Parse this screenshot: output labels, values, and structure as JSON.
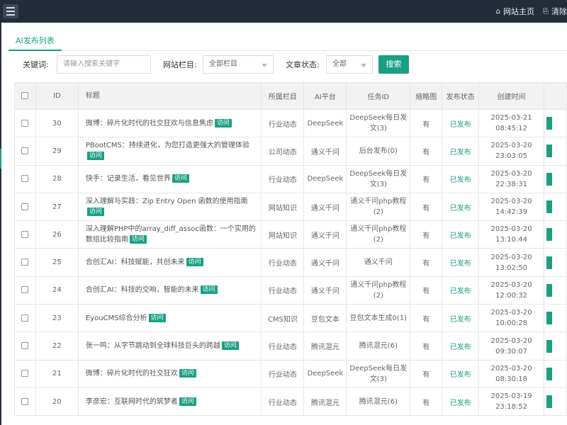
{
  "topbar": {
    "links": [
      {
        "icon": "home-icon",
        "glyph": "⌂",
        "label": "网站主页"
      },
      {
        "icon": "trash-icon",
        "glyph": "⎘",
        "label": "清除"
      }
    ]
  },
  "tab": {
    "label": "AI发布列表"
  },
  "filters": {
    "keyword_label": "关键词:",
    "keyword_placeholder": "请输入搜索关键字",
    "column_label": "网站栏目:",
    "column_value": "全部栏目",
    "status_label": "文章状态:",
    "status_value": "全部",
    "search_button": "搜索"
  },
  "table": {
    "headers": [
      "ID",
      "标题",
      "所属栏目",
      "AI平台",
      "任务ID",
      "缩略图",
      "发布状态",
      "创建时间"
    ],
    "visit_label": "访问",
    "rows": [
      {
        "id": "30",
        "title": "微博：碎片化时代的社交狂欢与信息焦虑",
        "column": "行业动态",
        "platform": "DeepSeek",
        "task": "DeepSeek每日发文(3)",
        "thumb": "有",
        "status": "已发布",
        "date": "2025-03-21",
        "time": "08:45:12"
      },
      {
        "id": "29",
        "title": "PBootCMS：持续进化，为您打造更强大的管理体验",
        "column": "公司动态",
        "platform": "通义千问",
        "task": "后台发布(0)",
        "thumb": "有",
        "status": "已发布",
        "date": "2025-03-20",
        "time": "23:03:05"
      },
      {
        "id": "28",
        "title": "快手：记录生活，看见世界",
        "column": "行业动态",
        "platform": "DeepSeek",
        "task": "DeepSeek每日发文(3)",
        "thumb": "有",
        "status": "已发布",
        "date": "2025-03-20",
        "time": "22:38:31"
      },
      {
        "id": "27",
        "title": "深入理解与实践：Zip Entry Open 函数的使用指南",
        "column": "网站知识",
        "platform": "通义千问",
        "task": "通义千问php教程(2)",
        "thumb": "有",
        "status": "已发布",
        "date": "2025-03-20",
        "time": "14:42:39"
      },
      {
        "id": "26",
        "title": "深入理解PHP中的array_diff_assoc函数：一个实用的数组比较指南",
        "column": "网站知识",
        "platform": "通义千问",
        "task": "通义千问php教程(2)",
        "thumb": "有",
        "status": "已发布",
        "date": "2025-03-20",
        "time": "13:10:44"
      },
      {
        "id": "25",
        "title": "合创汇AI：科技赋能，共创未来",
        "column": "行业动态",
        "platform": "通义千问",
        "task": "通义千问",
        "thumb": "有",
        "status": "已发布",
        "date": "2025-03-20",
        "time": "13:02:50"
      },
      {
        "id": "24",
        "title": "合创汇AI：科技的交响，智能的未来",
        "column": "行业动态",
        "platform": "通义千问",
        "task": "通义千问php教程(2)",
        "thumb": "有",
        "status": "已发布",
        "date": "2025-03-20",
        "time": "12:00:32"
      },
      {
        "id": "23",
        "title": "EyouCMS综合分析",
        "column": "CMS知识",
        "platform": "豆包文本",
        "task": "豆包文本生成0(1)",
        "thumb": "有",
        "status": "已发布",
        "date": "2025-03-20",
        "time": "10:00:28"
      },
      {
        "id": "22",
        "title": "张一鸣：从字节跳动到全球科技巨头的跨越",
        "column": "行业动态",
        "platform": "腾讯混元",
        "task": "腾讯混元(6)",
        "thumb": "有",
        "status": "已发布",
        "date": "2025-03-20",
        "time": "09:30:07"
      },
      {
        "id": "21",
        "title": "微博：碎片化时代的社交狂欢",
        "column": "行业动态",
        "platform": "DeepSeek",
        "task": "DeepSeek每日发文(3)",
        "thumb": "有",
        "status": "已发布",
        "date": "2025-03-20",
        "time": "08:30:18"
      },
      {
        "id": "20",
        "title": "李彦宏：互联网时代的筑梦者",
        "column": "行业动态",
        "platform": "腾讯混元",
        "task": "腾讯混元(6)",
        "thumb": "有",
        "status": "已发布",
        "date": "2025-03-19",
        "time": "23:18:52"
      }
    ]
  },
  "colors": {
    "accent": "#1aa083",
    "topbar": "#232c3a",
    "header_bg": "#f2f2f2"
  }
}
